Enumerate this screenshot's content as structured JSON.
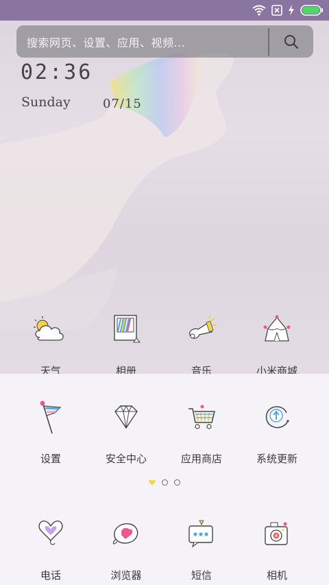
{
  "status_bar": {
    "icons": [
      "wifi-icon",
      "sim-disabled-icon",
      "charging-icon",
      "battery-icon"
    ],
    "battery_color": "#4cd964",
    "bar_color": "#8a74a0"
  },
  "search": {
    "placeholder": "搜索网页、设置、应用、视频...",
    "icon": "search-icon"
  },
  "clock": {
    "time": "02:36",
    "day": "Sunday",
    "date": "07/15"
  },
  "home_apps": [
    {
      "label": "天气",
      "icon": "weather-icon"
    },
    {
      "label": "相册",
      "icon": "gallery-icon"
    },
    {
      "label": "音乐",
      "icon": "music-icon"
    },
    {
      "label": "小米商城",
      "icon": "mi-store-icon"
    }
  ],
  "drawer_apps": [
    {
      "label": "设置",
      "icon": "settings-flag-icon"
    },
    {
      "label": "安全中心",
      "icon": "security-diamond-icon"
    },
    {
      "label": "应用商店",
      "icon": "app-store-cart-icon"
    },
    {
      "label": "系统更新",
      "icon": "system-update-icon"
    }
  ],
  "page_indicator": {
    "total": 3,
    "current": 1
  },
  "dock_apps": [
    {
      "label": "电话",
      "icon": "phone-heart-icon"
    },
    {
      "label": "浏览器",
      "icon": "browser-icon"
    },
    {
      "label": "短信",
      "icon": "messages-icon"
    },
    {
      "label": "相机",
      "icon": "camera-icon"
    }
  ],
  "colors": {
    "accent_yellow": "#f4d443",
    "accent_pink": "#e85a8c",
    "accent_blue": "#5aa6e0",
    "drawer_bg": "#f6f3f8"
  }
}
